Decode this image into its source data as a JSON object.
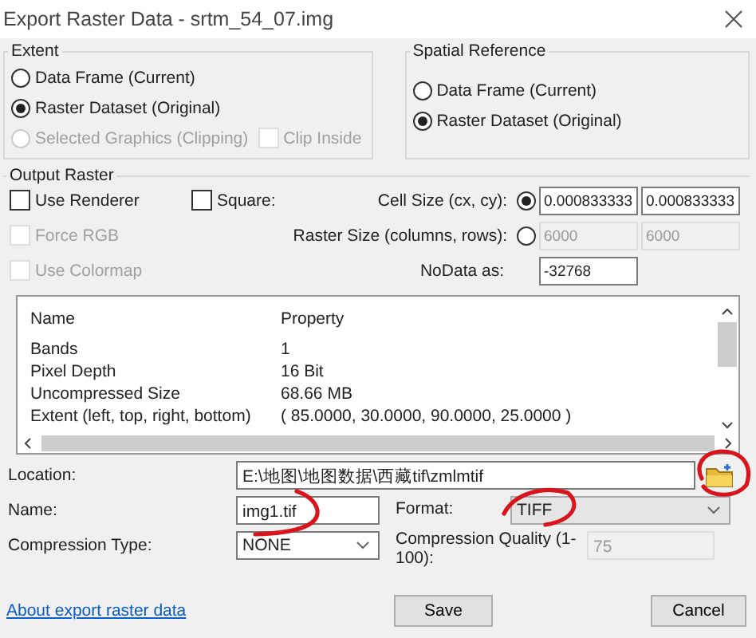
{
  "window": {
    "title": "Export Raster Data - srtm_54_07.img"
  },
  "extent": {
    "label": "Extent",
    "options": [
      {
        "label": "Data Frame (Current)",
        "selected": false,
        "disabled": false
      },
      {
        "label": "Raster Dataset (Original)",
        "selected": true,
        "disabled": false
      },
      {
        "label": "Selected Graphics (Clipping)",
        "selected": false,
        "disabled": true
      }
    ],
    "clip_inside": {
      "label": "Clip Inside",
      "checked": false,
      "disabled": true
    }
  },
  "spatial_reference": {
    "label": "Spatial Reference",
    "options": [
      {
        "label": "Data Frame (Current)",
        "selected": false
      },
      {
        "label": "Raster Dataset (Original)",
        "selected": true
      }
    ]
  },
  "output_raster": {
    "label": "Output Raster",
    "checkboxes": [
      {
        "label": "Use Renderer",
        "checked": false,
        "disabled": false
      },
      {
        "label": "Force RGB",
        "checked": false,
        "disabled": true
      },
      {
        "label": "Use Colormap",
        "checked": false,
        "disabled": true
      }
    ],
    "square": {
      "label": "Square:",
      "checked": false
    },
    "size_options": [
      {
        "label": "Cell Size (cx, cy):",
        "selected": true,
        "values": [
          "0.000833333",
          "0.000833333"
        ]
      },
      {
        "label": "Raster Size (columns, rows):",
        "selected": false,
        "values": [
          "6000",
          "6000"
        ]
      }
    ],
    "nodata": {
      "label": "NoData as:",
      "value": "-32768"
    }
  },
  "properties": {
    "columns": [
      "Name",
      "Property"
    ],
    "rows": [
      [
        "Bands",
        "1"
      ],
      [
        "Pixel Depth",
        "16 Bit"
      ],
      [
        "Uncompressed Size",
        "68.66 MB"
      ],
      [
        "Extent (left, top, right, bottom)",
        "( 85.0000, 30.0000, 90.0000, 25.0000 )"
      ]
    ]
  },
  "location": {
    "label": "Location:",
    "value": "E:\\地图\\地图数据\\西藏tif\\zmlmtif"
  },
  "name": {
    "label": "Name:",
    "value": "img1.tif"
  },
  "format": {
    "label": "Format:",
    "value": "TIFF"
  },
  "compression_type": {
    "label": "Compression Type:",
    "value": "NONE"
  },
  "compression_quality": {
    "label": "Compression Quality (1-100):",
    "value": "75",
    "disabled": true
  },
  "about_link": "About export raster data",
  "buttons": [
    "Save",
    "Cancel"
  ]
}
